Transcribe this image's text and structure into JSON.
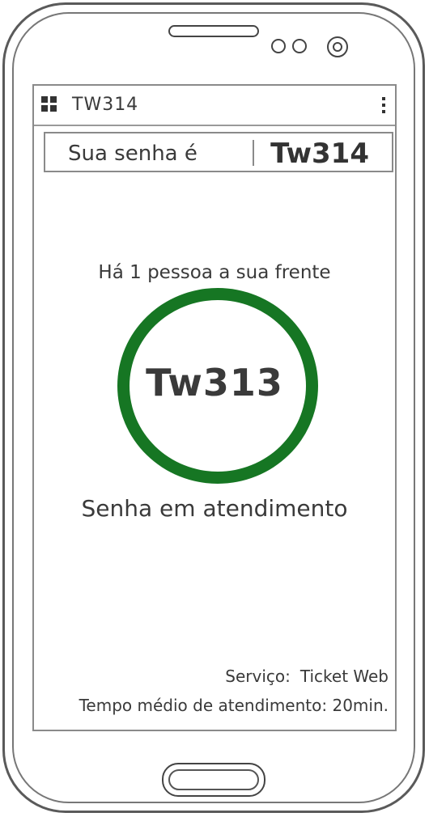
{
  "app": {
    "title": "TW314"
  },
  "ticket": {
    "label": "Sua senha é",
    "code": "Tw314"
  },
  "queue": {
    "ahead_text": "Há 1 pessoa a sua frente",
    "current_code": "Tw313",
    "status": "Senha em atendimento"
  },
  "info": {
    "service_label": "Serviço:",
    "service_value": "Ticket Web",
    "avg_label": "Tempo médio de atendimento:",
    "avg_value": "20min."
  },
  "icons": {
    "app_menu": "grid-icon",
    "overflow": "vertical-dots-icon"
  },
  "colors": {
    "ring": "#167623"
  }
}
